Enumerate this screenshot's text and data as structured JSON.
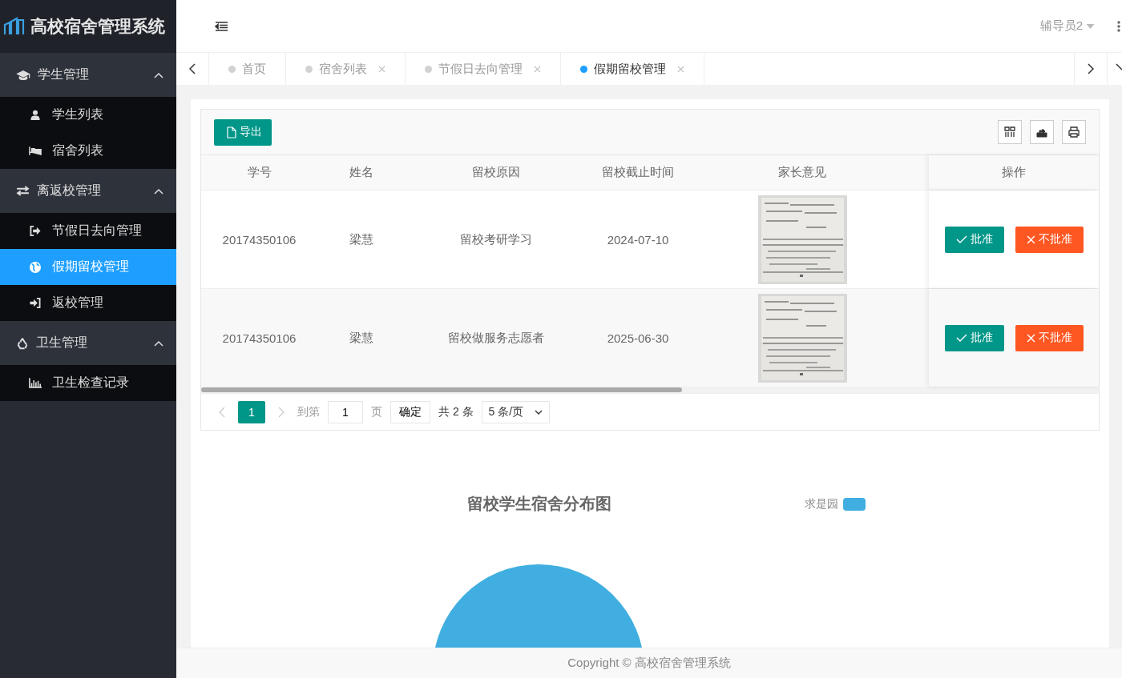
{
  "brand": {
    "title": "高校宿舍管理系统"
  },
  "header": {
    "user": "辅导员2"
  },
  "sidebar": {
    "groups": [
      {
        "label": "学生管理",
        "expanded": true,
        "items": [
          {
            "label": "学生列表",
            "selected": false
          },
          {
            "label": "宿舍列表",
            "selected": false
          }
        ]
      },
      {
        "label": "离返校管理",
        "expanded": true,
        "items": [
          {
            "label": "节假日去向管理",
            "selected": false
          },
          {
            "label": "假期留校管理",
            "selected": true
          },
          {
            "label": "返校管理",
            "selected": false
          }
        ]
      },
      {
        "label": "卫生管理",
        "expanded": true,
        "items": [
          {
            "label": "卫生检查记录",
            "selected": false
          }
        ]
      }
    ]
  },
  "tabs": [
    {
      "label": "首页",
      "selected": false,
      "closable": false
    },
    {
      "label": "宿舍列表",
      "selected": false,
      "closable": true
    },
    {
      "label": "节假日去向管理",
      "selected": false,
      "closable": true
    },
    {
      "label": "假期留校管理",
      "selected": true,
      "closable": true
    }
  ],
  "toolbar": {
    "export": "导出"
  },
  "table": {
    "columns": [
      "学号",
      "姓名",
      "留校原因",
      "留校截止时间",
      "家长意见",
      "操作"
    ],
    "rows": [
      {
        "student_id": "20174350106",
        "name": "梁慧",
        "reason": "留校考研学习",
        "until": "2024-07-10",
        "opinion": {
          "kind": "picture"
        },
        "actions": [
          "批准",
          "不批准"
        ]
      },
      {
        "student_id": "20174350106",
        "name": "梁慧",
        "reason": "留校做服务志愿者",
        "until": "2025-06-30",
        "opinion": {
          "kind": "picture"
        },
        "actions": [
          "批准",
          "不批准"
        ]
      }
    ]
  },
  "pagination": {
    "pages": [
      {
        "label": "1",
        "selected": true
      }
    ],
    "goto_label": "到第",
    "goto_value": "1",
    "page_unit": "页",
    "confirm": "确定",
    "total": "共 2 条",
    "page_size": "5 条/页"
  },
  "chart": {
    "title": "留校学生宿舍分布图",
    "legend": [
      {
        "label": "求是园",
        "color": "#40aee0"
      }
    ]
  },
  "footer": "Copyright © 高校宿舍管理系统"
}
